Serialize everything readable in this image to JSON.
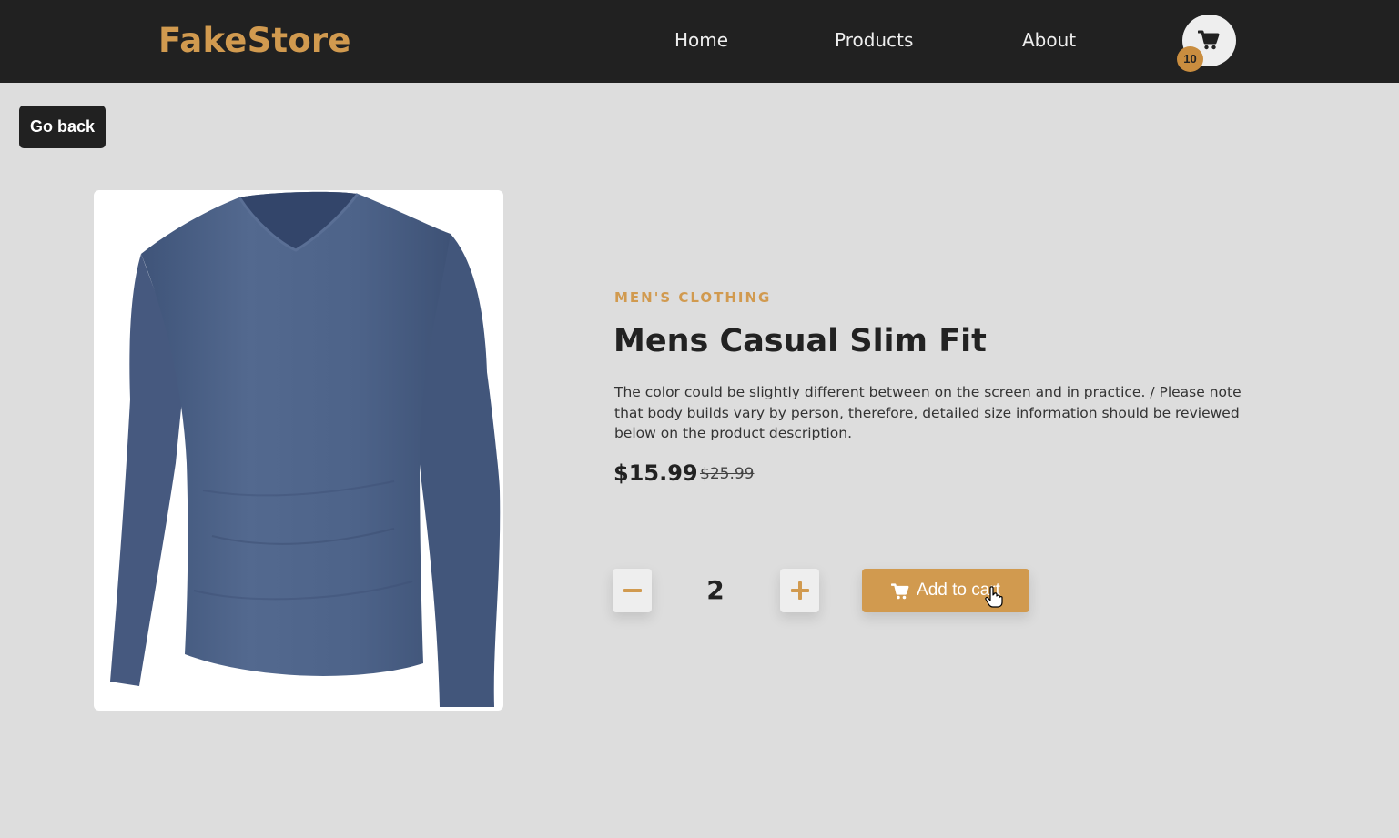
{
  "navbar": {
    "brand": "FakeStore",
    "links": [
      {
        "label": "Home"
      },
      {
        "label": "Products"
      },
      {
        "label": "About"
      }
    ],
    "cart": {
      "icon": "shopping-cart-icon",
      "count": "10"
    }
  },
  "go_back_label": "Go back",
  "product": {
    "category": "MEN'S CLOTHING",
    "title": "Mens Casual Slim Fit",
    "description": "The color could be slightly different between on the screen and in practice. / Please note that body builds vary by person, therefore, detailed size information should be reviewed below on the product description.",
    "price": "$15.99",
    "original_price": "$25.99",
    "image_alt": "Blue long sleeve v-neck t-shirt"
  },
  "quantity": {
    "value": "2",
    "decrease_icon": "minus-icon",
    "increase_icon": "plus-icon"
  },
  "add_to_cart_label": "Add to cart",
  "colors": {
    "accent": "#d19a4f",
    "navbar": "#212121",
    "background": "#dddddd",
    "shirt": "#4b6189"
  }
}
